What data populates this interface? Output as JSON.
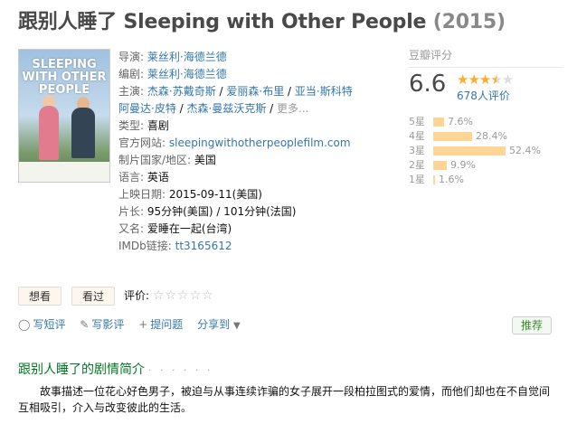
{
  "page": {
    "title_cn": "跟别人睡了",
    "title_en": "Sleeping with Other People",
    "year": "(2015)"
  },
  "poster": {
    "title_lines": [
      "SLEEPING",
      "WITH OTHER",
      "PEOPLE"
    ]
  },
  "info": {
    "director_label": "导演:",
    "director": "莱丝利·海德兰德",
    "writer_label": "编剧:",
    "writer": "莱丝利·海德兰德",
    "cast_label": "主演:",
    "cast": [
      "杰森·苏戴奇斯",
      "爱丽森·布里",
      "亚当·斯科特",
      "阿曼达·皮特",
      "杰森·曼兹沃克斯"
    ],
    "cast_sep": " / ",
    "more": "更多...",
    "genre_label": "类型:",
    "genre": "喜剧",
    "site_label": "官方网站:",
    "site": "sleepingwithotherpeoplefilm.com",
    "country_label": "制片国家/地区:",
    "country": "美国",
    "language_label": "语言:",
    "language": "英语",
    "release_label": "上映日期:",
    "release": "2015-09-11(美国)",
    "runtime_label": "片长:",
    "runtime": "95分钟(美国) / 101分钟(法国)",
    "aka_label": "又名:",
    "aka": "爱睡在一起(台湾)",
    "imdb_label": "IMDb链接:",
    "imdb": "tt3165612"
  },
  "rating": {
    "label": "豆瓣评分",
    "score": "6.6",
    "stars": 3.5,
    "votes": "678人评价",
    "distribution": [
      {
        "label": "5星",
        "percent": 7.6,
        "text": "7.6%"
      },
      {
        "label": "4星",
        "percent": 28.4,
        "text": "28.4%"
      },
      {
        "label": "3星",
        "percent": 52.4,
        "text": "52.4%"
      },
      {
        "label": "2星",
        "percent": 9.9,
        "text": "9.9%"
      },
      {
        "label": "1星",
        "percent": 1.6,
        "text": "1.6%"
      }
    ]
  },
  "buttons": {
    "want": "想看",
    "seen": "看过",
    "rate_label": "评价:"
  },
  "actions": {
    "short_review": "写短评",
    "review": "写影评",
    "question": "提问题",
    "share": "分享到",
    "recommend": "推荐"
  },
  "synopsis": {
    "title": "跟别人睡了的剧情简介",
    "dots": "· · · · · ·",
    "text": "故事描述一位花心好色男子，被迫与从事连续诈骗的女子展开一段柏拉图式的爱情，而他们却也在不自觉间互相吸引，介入与改变彼此的生活。"
  },
  "colors": {
    "link": "#3377aa",
    "star": "#ffac2d",
    "bar": "#ffd596",
    "green": "#007722"
  }
}
